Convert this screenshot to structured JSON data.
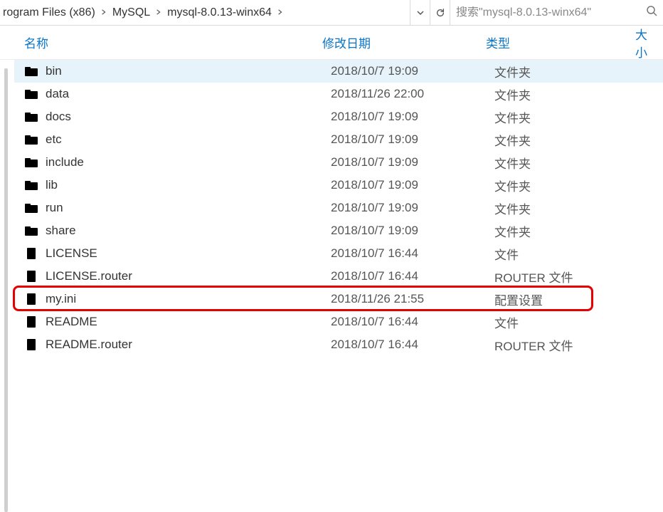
{
  "breadcrumb": {
    "items": [
      {
        "label": "rogram Files (x86)"
      },
      {
        "label": "MySQL"
      },
      {
        "label": "mysql-8.0.13-winx64"
      }
    ]
  },
  "search": {
    "placeholder": "搜索\"mysql-8.0.13-winx64\""
  },
  "columns": {
    "name": "名称",
    "date": "修改日期",
    "type": "类型",
    "size": "大小"
  },
  "rows": [
    {
      "icon": "folder",
      "name": "bin",
      "date": "2018/10/7 19:09",
      "type": "文件夹",
      "selected": true
    },
    {
      "icon": "folder",
      "name": "data",
      "date": "2018/11/26 22:00",
      "type": "文件夹",
      "selected": false
    },
    {
      "icon": "folder",
      "name": "docs",
      "date": "2018/10/7 19:09",
      "type": "文件夹",
      "selected": false
    },
    {
      "icon": "folder",
      "name": "etc",
      "date": "2018/10/7 19:09",
      "type": "文件夹",
      "selected": false
    },
    {
      "icon": "folder",
      "name": "include",
      "date": "2018/10/7 19:09",
      "type": "文件夹",
      "selected": false
    },
    {
      "icon": "folder",
      "name": "lib",
      "date": "2018/10/7 19:09",
      "type": "文件夹",
      "selected": false
    },
    {
      "icon": "folder",
      "name": "run",
      "date": "2018/10/7 19:09",
      "type": "文件夹",
      "selected": false
    },
    {
      "icon": "folder",
      "name": "share",
      "date": "2018/10/7 19:09",
      "type": "文件夹",
      "selected": false
    },
    {
      "icon": "file",
      "name": "LICENSE",
      "date": "2018/10/7 16:44",
      "type": "文件",
      "selected": false
    },
    {
      "icon": "file",
      "name": "LICENSE.router",
      "date": "2018/10/7 16:44",
      "type": "ROUTER 文件",
      "selected": false
    },
    {
      "icon": "ini",
      "name": "my.ini",
      "date": "2018/11/26 21:55",
      "type": "配置设置",
      "selected": false,
      "highlighted": true
    },
    {
      "icon": "file",
      "name": "README",
      "date": "2018/10/7 16:44",
      "type": "文件",
      "selected": false
    },
    {
      "icon": "file",
      "name": "README.router",
      "date": "2018/10/7 16:44",
      "type": "ROUTER 文件",
      "selected": false
    }
  ]
}
